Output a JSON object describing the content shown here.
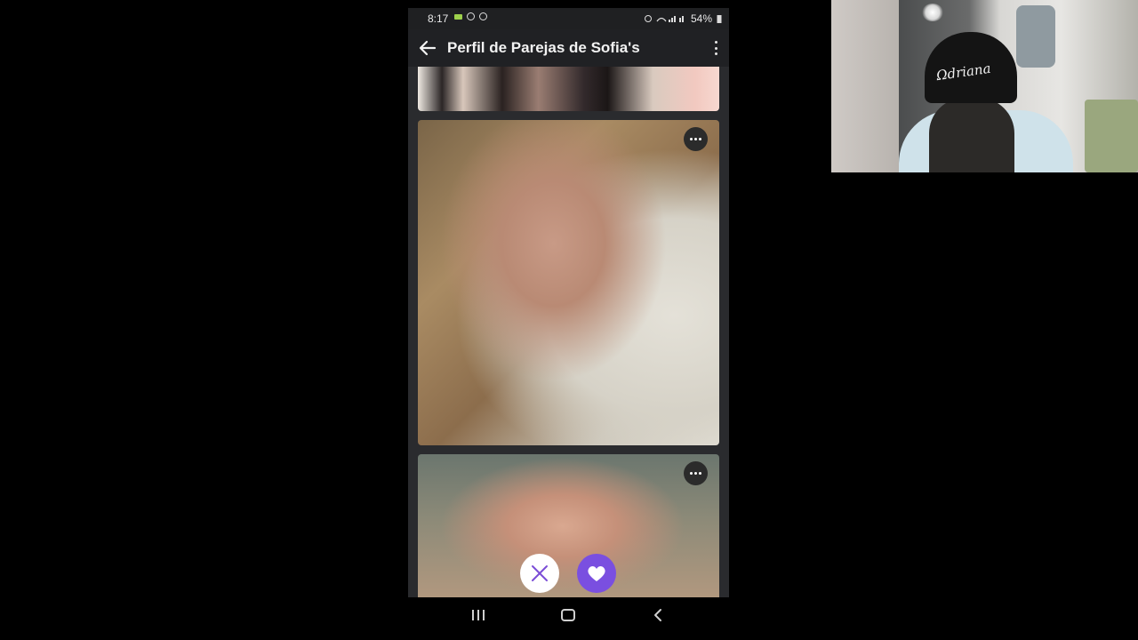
{
  "status_bar": {
    "time": "8:17",
    "battery_percent": "54%"
  },
  "app_bar": {
    "title": "Perfil de Parejas de Sofia's"
  },
  "icons": {
    "back": "arrow-left-icon",
    "more": "more-vertical-icon",
    "photo_menu": "more-horizontal-icon",
    "dislike": "close-icon",
    "like": "heart-icon",
    "recents": "recents-icon",
    "home": "home-icon",
    "nav_back": "chevron-left-icon"
  },
  "webcam": {
    "cap_text": "Ωdriana"
  },
  "colors": {
    "accent": "#7a4fe0",
    "background": "#000000",
    "app_surface": "#202124"
  }
}
